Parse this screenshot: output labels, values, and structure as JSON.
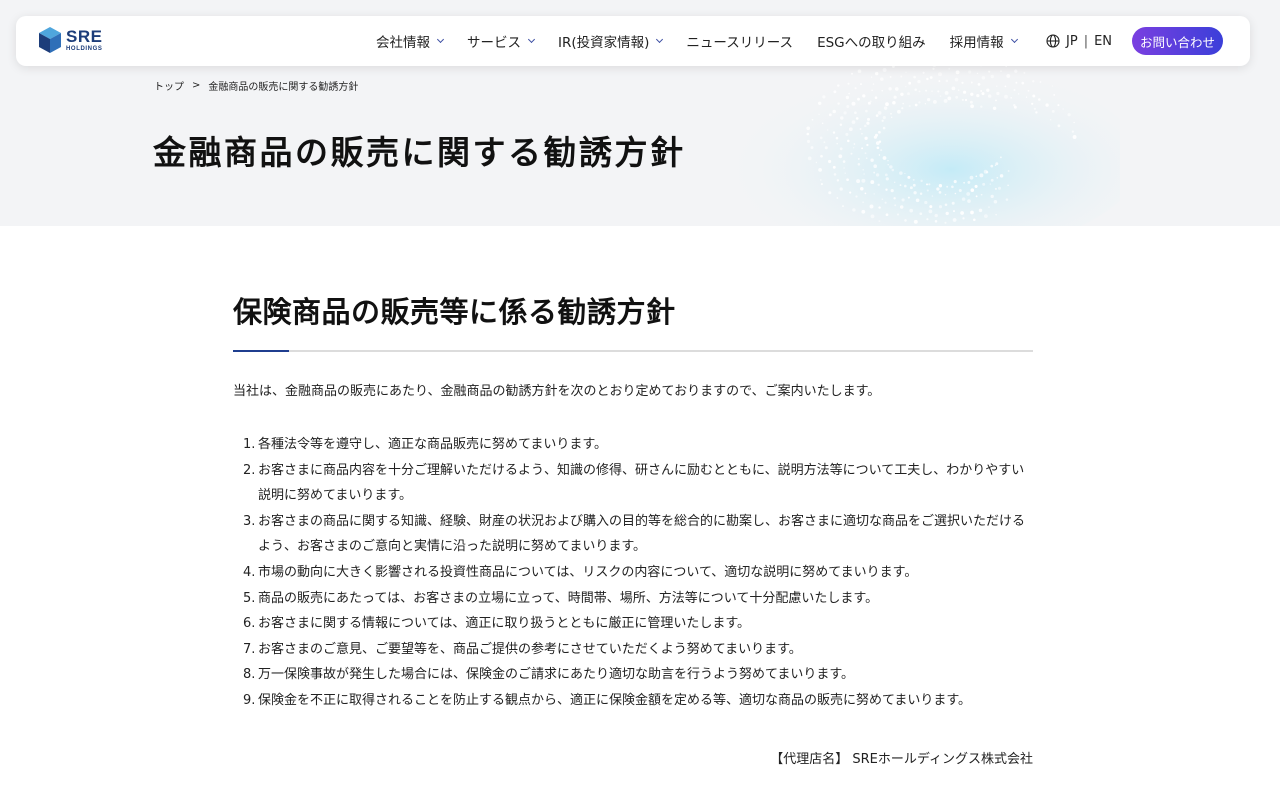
{
  "header": {
    "logo_text": "SRE",
    "logo_sub": "HOLDINGS",
    "nav": [
      {
        "label": "会社情報",
        "dropdown": true
      },
      {
        "label": "サービス",
        "dropdown": true
      },
      {
        "label": "IR(投資家情報)",
        "dropdown": true
      },
      {
        "label": "ニュースリリース",
        "dropdown": false
      },
      {
        "label": "ESGへの取り組み",
        "dropdown": false
      },
      {
        "label": "採用情報",
        "dropdown": true
      }
    ],
    "lang_jp": "JP",
    "lang_separator": "|",
    "lang_en": "EN",
    "contact_label": "お問い合わせ"
  },
  "breadcrumb": {
    "home": "トップ",
    "separator": ">",
    "current": "金融商品の販売に関する勧誘方針"
  },
  "page_title": "金融商品の販売に関する勧誘方針",
  "section": {
    "title": "保険商品の販売等に係る勧誘方針",
    "intro": "当社は、金融商品の販売にあたり、金融商品の勧誘方針を次のとおり定めておりますので、ご案内いたします。",
    "items": [
      "各種法令等を遵守し、適正な商品販売に努めてまいります。",
      "お客さまに商品内容を十分ご理解いただけるよう、知識の修得、研さんに励むとともに、説明方法等について工夫し、わかりやすい説明に努めてまいります。",
      "お客さまの商品に関する知識、経験、財産の状況および購入の目的等を総合的に勘案し、お客さまに適切な商品をご選択いただけるよう、お客さまのご意向と実情に沿った説明に努めてまいります。",
      "市場の動向に大きく影響される投資性商品については、リスクの内容について、適切な説明に努めてまいります。",
      "商品の販売にあたっては、お客さまの立場に立って、時間帯、場所、方法等について十分配慮いたします。",
      "お客さまに関する情報については、適正に取り扱うとともに厳正に管理いたします。",
      "お客さまのご意見、ご要望等を、商品ご提供の参考にさせていただくよう努めてまいります。",
      "万一保険事故が発生した場合には、保険金のご請求にあたり適切な助言を行うよう努めてまいります。",
      "保険金を不正に取得されることを防止する観点から、適正に保険金額を定める等、適切な商品の販売に努めてまいります。"
    ],
    "agent": "【代理店名】 SREホールディングス株式会社"
  },
  "colors": {
    "brand_navy": "#1d3d7a",
    "accent_blue": "#1f3e8f",
    "contact_gradient_start": "#7a3fe0",
    "contact_gradient_end": "#3b3fd9"
  }
}
